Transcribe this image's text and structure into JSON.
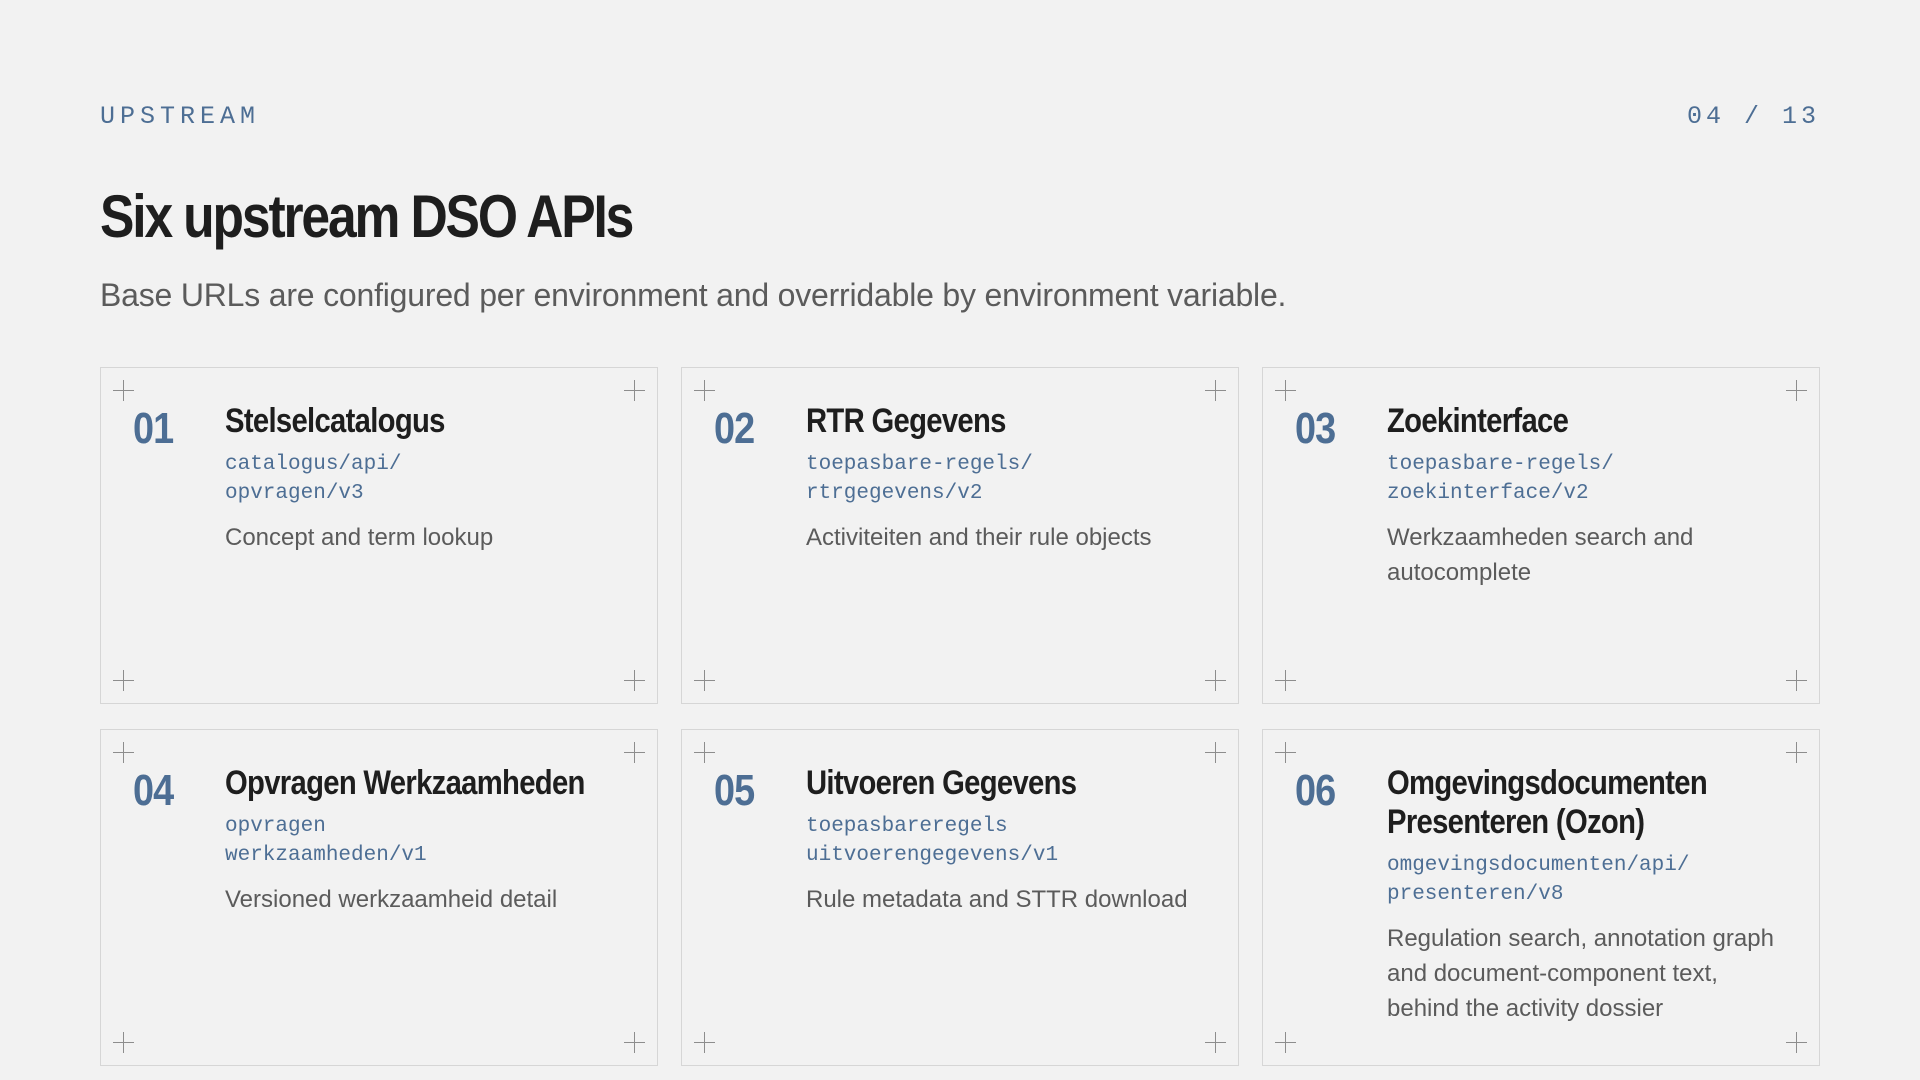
{
  "header": {
    "eyebrow": "UPSTREAM",
    "pager": "04 / 13",
    "title": "Six upstream DSO APIs",
    "subtitle": "Base URLs are configured per environment and overridable by environment variable."
  },
  "apis": [
    {
      "number": "01",
      "name": "Stelselcatalogus",
      "path_line1": "catalogus/api/",
      "path_line2": "opvragen/v3",
      "description": "Concept and term lookup"
    },
    {
      "number": "02",
      "name": "RTR Gegevens",
      "path_line1": "toepasbare-regels/",
      "path_line2": "rtrgegevens/v2",
      "description": "Activiteiten and their rule objects"
    },
    {
      "number": "03",
      "name": "Zoekinterface",
      "path_line1": "toepasbare-regels/",
      "path_line2": "zoekinterface/v2",
      "description": "Werkzaamheden search and autocomplete"
    },
    {
      "number": "04",
      "name": "Opvragen Werkzaamheden",
      "path_line1": "opvragen",
      "path_line2": "werkzaamheden/v1",
      "description": "Versioned werkzaamheid detail"
    },
    {
      "number": "05",
      "name": "Uitvoeren Gegevens",
      "path_line1": "toepasbareregels",
      "path_line2": "uitvoerengegevens/v1",
      "description": "Rule metadata and STTR download"
    },
    {
      "number": "06",
      "name": "Omgevingsdocumenten Presenteren (Ozon)",
      "path_line1": "omgevingsdocumenten/api/",
      "path_line2": "presenteren/v8",
      "description": "Regulation search, annotation graph and document-component text, behind the activity dossier"
    }
  ],
  "colors": {
    "background": "#f2f2f2",
    "accent": "#4d6e94",
    "heading": "#1e1e1e",
    "muted": "#5b5b5b",
    "border": "#d6d6d6"
  },
  "icons": {
    "card_corner": "plus-icon"
  }
}
